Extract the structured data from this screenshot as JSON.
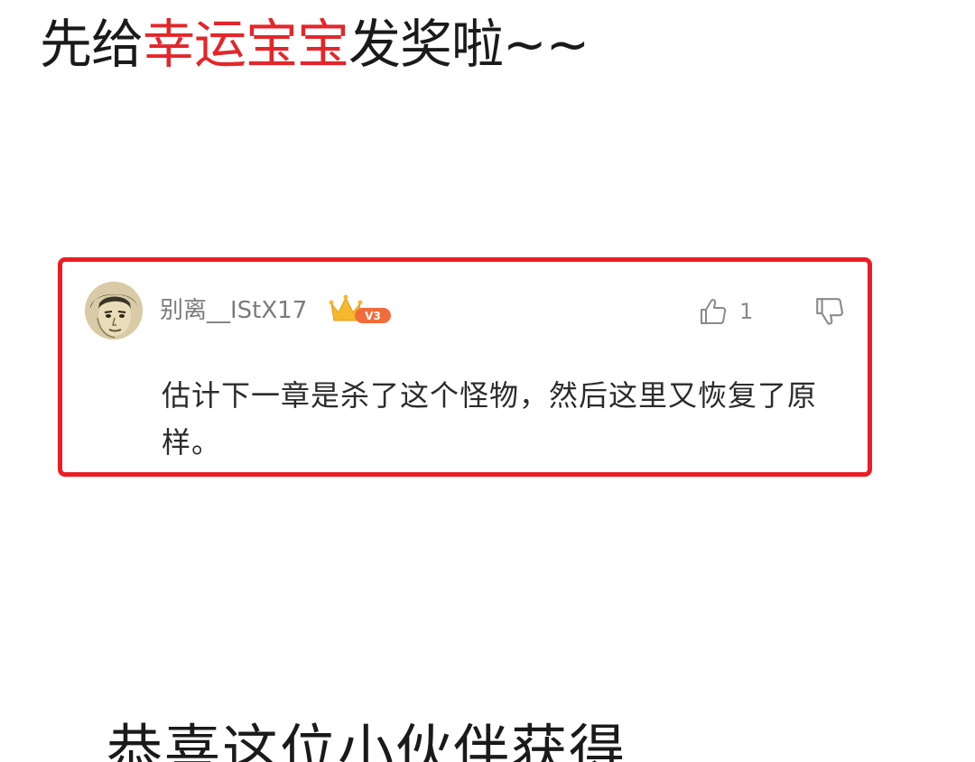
{
  "headline": {
    "prefix": "先给",
    "highlight": "幸运宝宝",
    "suffix": "发奖啦~~"
  },
  "comment": {
    "username": "别离__IStX17",
    "badge_level": "V3",
    "like_count": "1",
    "text": "估计下一章是杀了这个怪物，然后这里又恢复了原样。"
  },
  "caption": {
    "text": "恭喜这位小伙伴获得"
  },
  "colors": {
    "highlight": "#e3262b",
    "card_border": "#ec1c24",
    "badge": "#f26b3a",
    "crown": "#f5b82e"
  },
  "icons": {
    "avatar": "anime-face-avatar",
    "crown": "crown-icon",
    "like": "thumbs-up-icon",
    "dislike": "thumbs-down-icon"
  }
}
